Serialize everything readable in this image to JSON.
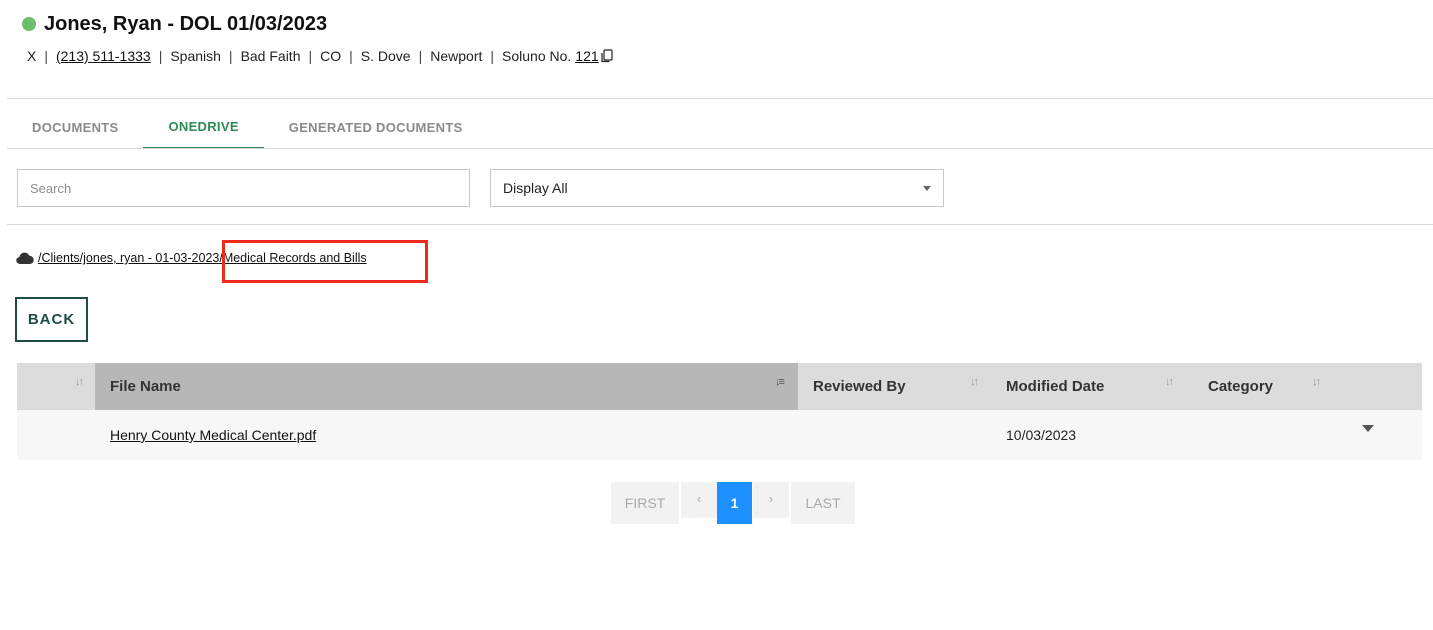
{
  "header": {
    "title": "Jones, Ryan - DOL 01/03/2023",
    "status_color": "#6cbf6a",
    "info": {
      "x": "X",
      "phone": "(213) 511-1333",
      "language": "Spanish",
      "case_type": "Bad Faith",
      "state": "CO",
      "attorney": "S. Dove",
      "office": "Newport",
      "soluno_label": "Soluno No.",
      "soluno_number": "121"
    }
  },
  "tabs": [
    {
      "label": "DOCUMENTS",
      "active": false
    },
    {
      "label": "ONEDRIVE",
      "active": true
    },
    {
      "label": "GENERATED DOCUMENTS",
      "active": false
    }
  ],
  "filters": {
    "search_placeholder": "Search",
    "display_value": "Display All"
  },
  "breadcrumb": {
    "icon": "cloud-icon",
    "path": "/Clients/jones, ryan - 01-03-2023/Medical Records and Bills",
    "highlight_color": "#ee2a1b"
  },
  "back_label": "BACK",
  "table": {
    "columns": [
      "",
      "File Name",
      "Reviewed By",
      "Modified Date",
      "Category"
    ],
    "rows": [
      {
        "file_name": "Henry County Medical Center.pdf",
        "reviewed_by": "",
        "modified_date": "10/03/2023",
        "category": ""
      }
    ]
  },
  "pagination": {
    "first": "FIRST",
    "prev": "‹",
    "current": "1",
    "next": "›",
    "last": "LAST",
    "active_color": "#1e90ff"
  }
}
